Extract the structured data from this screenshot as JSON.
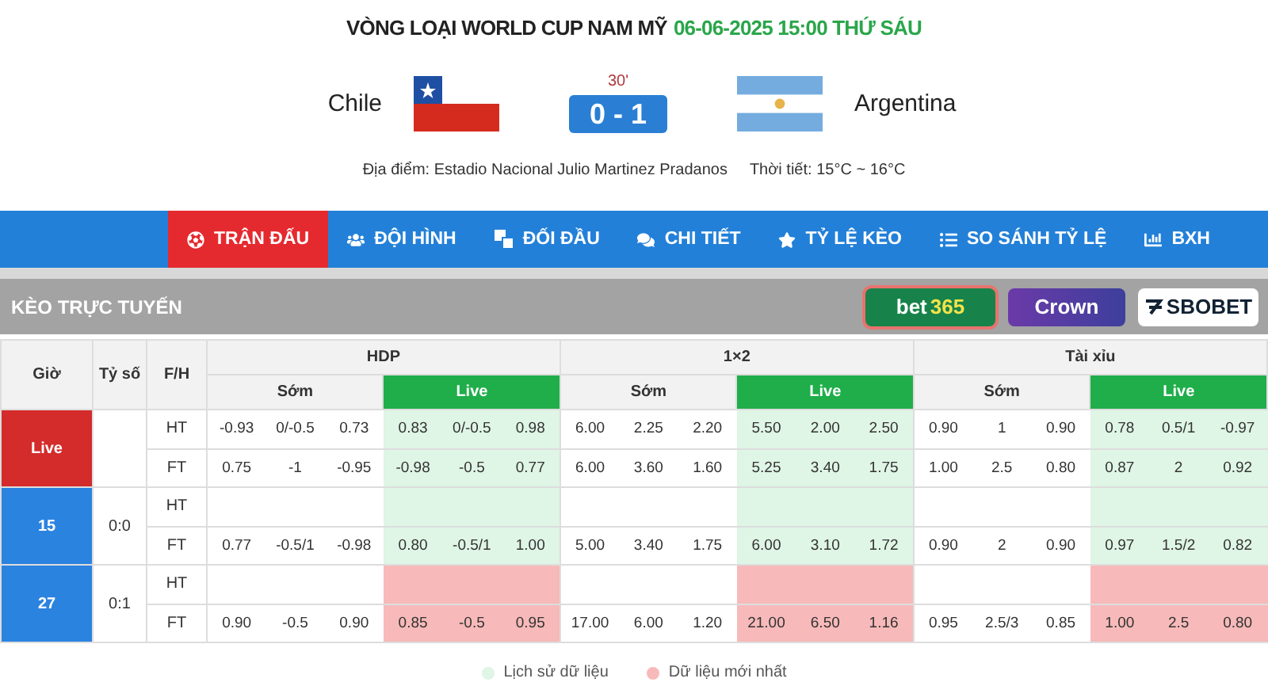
{
  "header": {
    "competition": "VÒNG LOẠI WORLD CUP NAM MỸ",
    "datetime": "06-06-2025 15:00 THỨ SÁU"
  },
  "match": {
    "home": "Chile",
    "away": "Argentina",
    "minute": "30'",
    "score": "0 - 1",
    "venue_label": "Địa điểm:",
    "venue": "Estadio Nacional Julio Martinez Pradanos",
    "weather_label": "Thời tiết:",
    "weather": "15°C ~ 16°C"
  },
  "tabs": [
    {
      "label": "TRẬN ĐẤU",
      "selected": true
    },
    {
      "label": "ĐỘI HÌNH",
      "selected": false
    },
    {
      "label": "ĐỐI ĐẦU",
      "selected": false
    },
    {
      "label": "CHI TIẾT",
      "selected": false
    },
    {
      "label": "TỶ LỆ KÈO",
      "selected": false
    },
    {
      "label": "SO SÁNH TỶ LỆ",
      "selected": false
    },
    {
      "label": "BXH",
      "selected": false
    }
  ],
  "odds_panel": {
    "title": "KÈO TRỰC TUYẾN",
    "bookmakers": [
      {
        "kind": "bet365",
        "label": "bet",
        "label_accent": "365",
        "selected": true
      },
      {
        "kind": "crown",
        "label": "Crown",
        "selected": false
      },
      {
        "kind": "sbobet",
        "label": "SBOBET",
        "selected": false
      }
    ],
    "columns": [
      "Giờ",
      "Tỷ số",
      "F/H"
    ],
    "markets": [
      {
        "label": "HDP",
        "phases": [
          "Sớm",
          "Live"
        ]
      },
      {
        "label": "1×2",
        "phases": [
          "Sớm",
          "Live"
        ]
      },
      {
        "label": "Tài xỉu",
        "phases": [
          "Sớm",
          "Live"
        ]
      }
    ],
    "groups": [
      {
        "time": "Live",
        "kind": "live",
        "latest": false,
        "lines": [
          {
            "label": "HT",
            "odds": [
              "-0.93",
              "0/-0.5",
              "0.73",
              "0.83",
              "0/-0.5",
              "0.98",
              "6.00",
              "2.25",
              "2.20",
              "5.50",
              "2.00",
              "2.50",
              "0.90",
              "1",
              "0.90",
              "0.78",
              "0.5/1",
              "-0.97"
            ]
          },
          {
            "label": "FT",
            "odds": [
              "0.75",
              "-1",
              "-0.95",
              "-0.98",
              "-0.5",
              "0.77",
              "6.00",
              "3.60",
              "1.60",
              "5.25",
              "3.40",
              "1.75",
              "1.00",
              "2.5",
              "0.80",
              "0.87",
              "2",
              "0.92"
            ]
          }
        ]
      },
      {
        "time": "15",
        "kind": "minute",
        "score": "0:0",
        "latest": false,
        "lines": [
          {
            "label": "HT"
          },
          {
            "label": "FT",
            "odds": [
              "0.77",
              "-0.5/1",
              "-0.98",
              "0.80",
              "-0.5/1",
              "1.00",
              "5.00",
              "3.40",
              "1.75",
              "6.00",
              "3.10",
              "1.72",
              "0.90",
              "2",
              "0.90",
              "0.97",
              "1.5/2",
              "0.82"
            ]
          }
        ]
      },
      {
        "time": "27",
        "kind": "minute",
        "score": "0:1",
        "latest": true,
        "lines": [
          {
            "label": "HT"
          },
          {
            "label": "FT",
            "odds": [
              "0.90",
              "-0.5",
              "0.90",
              "0.85",
              "-0.5",
              "0.95",
              "17.00",
              "6.00",
              "1.20",
              "21.00",
              "6.50",
              "1.16",
              "0.95",
              "2.5/3",
              "0.85",
              "1.00",
              "2.5",
              "0.80"
            ]
          }
        ]
      }
    ],
    "legend": [
      {
        "label": "Lịch sử dữ liệu",
        "color": "#dff5e5"
      },
      {
        "label": "Dữ liệu mới nhất",
        "color": "#f7b9b9"
      }
    ]
  }
}
